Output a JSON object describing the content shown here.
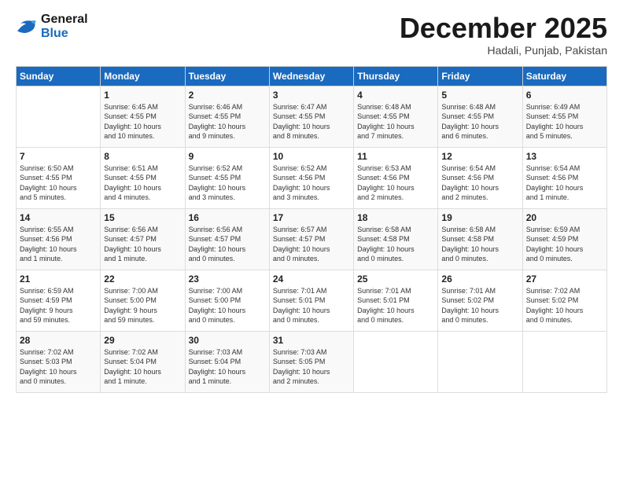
{
  "header": {
    "logo_line1": "General",
    "logo_line2": "Blue",
    "month": "December 2025",
    "location": "Hadali, Punjab, Pakistan"
  },
  "days_of_week": [
    "Sunday",
    "Monday",
    "Tuesday",
    "Wednesday",
    "Thursday",
    "Friday",
    "Saturday"
  ],
  "weeks": [
    [
      {
        "day": "",
        "info": ""
      },
      {
        "day": "1",
        "info": "Sunrise: 6:45 AM\nSunset: 4:55 PM\nDaylight: 10 hours\nand 10 minutes."
      },
      {
        "day": "2",
        "info": "Sunrise: 6:46 AM\nSunset: 4:55 PM\nDaylight: 10 hours\nand 9 minutes."
      },
      {
        "day": "3",
        "info": "Sunrise: 6:47 AM\nSunset: 4:55 PM\nDaylight: 10 hours\nand 8 minutes."
      },
      {
        "day": "4",
        "info": "Sunrise: 6:48 AM\nSunset: 4:55 PM\nDaylight: 10 hours\nand 7 minutes."
      },
      {
        "day": "5",
        "info": "Sunrise: 6:48 AM\nSunset: 4:55 PM\nDaylight: 10 hours\nand 6 minutes."
      },
      {
        "day": "6",
        "info": "Sunrise: 6:49 AM\nSunset: 4:55 PM\nDaylight: 10 hours\nand 5 minutes."
      }
    ],
    [
      {
        "day": "7",
        "info": "Sunrise: 6:50 AM\nSunset: 4:55 PM\nDaylight: 10 hours\nand 5 minutes."
      },
      {
        "day": "8",
        "info": "Sunrise: 6:51 AM\nSunset: 4:55 PM\nDaylight: 10 hours\nand 4 minutes."
      },
      {
        "day": "9",
        "info": "Sunrise: 6:52 AM\nSunset: 4:55 PM\nDaylight: 10 hours\nand 3 minutes."
      },
      {
        "day": "10",
        "info": "Sunrise: 6:52 AM\nSunset: 4:56 PM\nDaylight: 10 hours\nand 3 minutes."
      },
      {
        "day": "11",
        "info": "Sunrise: 6:53 AM\nSunset: 4:56 PM\nDaylight: 10 hours\nand 2 minutes."
      },
      {
        "day": "12",
        "info": "Sunrise: 6:54 AM\nSunset: 4:56 PM\nDaylight: 10 hours\nand 2 minutes."
      },
      {
        "day": "13",
        "info": "Sunrise: 6:54 AM\nSunset: 4:56 PM\nDaylight: 10 hours\nand 1 minute."
      }
    ],
    [
      {
        "day": "14",
        "info": "Sunrise: 6:55 AM\nSunset: 4:56 PM\nDaylight: 10 hours\nand 1 minute."
      },
      {
        "day": "15",
        "info": "Sunrise: 6:56 AM\nSunset: 4:57 PM\nDaylight: 10 hours\nand 1 minute."
      },
      {
        "day": "16",
        "info": "Sunrise: 6:56 AM\nSunset: 4:57 PM\nDaylight: 10 hours\nand 0 minutes."
      },
      {
        "day": "17",
        "info": "Sunrise: 6:57 AM\nSunset: 4:57 PM\nDaylight: 10 hours\nand 0 minutes."
      },
      {
        "day": "18",
        "info": "Sunrise: 6:58 AM\nSunset: 4:58 PM\nDaylight: 10 hours\nand 0 minutes."
      },
      {
        "day": "19",
        "info": "Sunrise: 6:58 AM\nSunset: 4:58 PM\nDaylight: 10 hours\nand 0 minutes."
      },
      {
        "day": "20",
        "info": "Sunrise: 6:59 AM\nSunset: 4:59 PM\nDaylight: 10 hours\nand 0 minutes."
      }
    ],
    [
      {
        "day": "21",
        "info": "Sunrise: 6:59 AM\nSunset: 4:59 PM\nDaylight: 9 hours\nand 59 minutes."
      },
      {
        "day": "22",
        "info": "Sunrise: 7:00 AM\nSunset: 5:00 PM\nDaylight: 9 hours\nand 59 minutes."
      },
      {
        "day": "23",
        "info": "Sunrise: 7:00 AM\nSunset: 5:00 PM\nDaylight: 10 hours\nand 0 minutes."
      },
      {
        "day": "24",
        "info": "Sunrise: 7:01 AM\nSunset: 5:01 PM\nDaylight: 10 hours\nand 0 minutes."
      },
      {
        "day": "25",
        "info": "Sunrise: 7:01 AM\nSunset: 5:01 PM\nDaylight: 10 hours\nand 0 minutes."
      },
      {
        "day": "26",
        "info": "Sunrise: 7:01 AM\nSunset: 5:02 PM\nDaylight: 10 hours\nand 0 minutes."
      },
      {
        "day": "27",
        "info": "Sunrise: 7:02 AM\nSunset: 5:02 PM\nDaylight: 10 hours\nand 0 minutes."
      }
    ],
    [
      {
        "day": "28",
        "info": "Sunrise: 7:02 AM\nSunset: 5:03 PM\nDaylight: 10 hours\nand 0 minutes."
      },
      {
        "day": "29",
        "info": "Sunrise: 7:02 AM\nSunset: 5:04 PM\nDaylight: 10 hours\nand 1 minute."
      },
      {
        "day": "30",
        "info": "Sunrise: 7:03 AM\nSunset: 5:04 PM\nDaylight: 10 hours\nand 1 minute."
      },
      {
        "day": "31",
        "info": "Sunrise: 7:03 AM\nSunset: 5:05 PM\nDaylight: 10 hours\nand 2 minutes."
      },
      {
        "day": "",
        "info": ""
      },
      {
        "day": "",
        "info": ""
      },
      {
        "day": "",
        "info": ""
      }
    ]
  ]
}
